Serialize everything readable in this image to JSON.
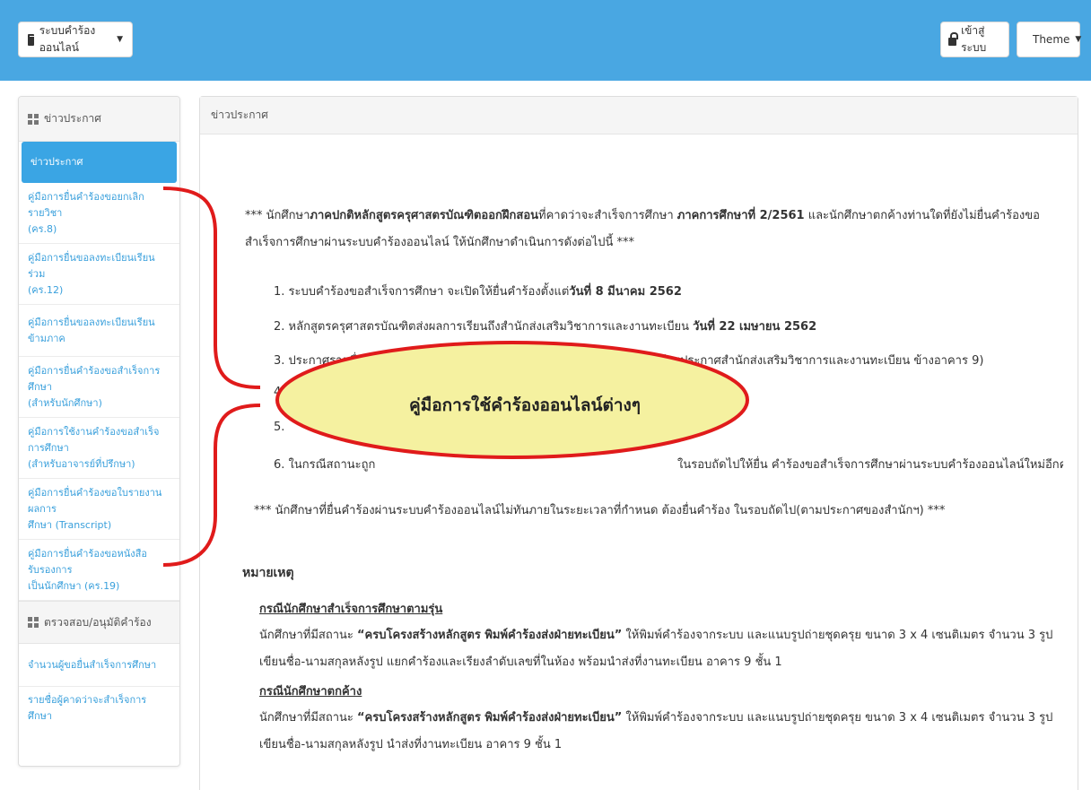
{
  "navbar": {
    "brand_label": "ระบบคำร้องออนไลน์",
    "login_label": "เข้าสู่ระบบ",
    "theme_label": "Theme",
    "background": "#49a7e2"
  },
  "sidebar": {
    "section1_title": "ข่าวประกาศ",
    "items": [
      {
        "label": "ข่าวประกาศ",
        "active": true
      },
      {
        "line1": "คู่มือการยื่นคำร้องขอยกเลิกรายวิชา",
        "line2": "(คร.8)"
      },
      {
        "line1": "คู่มือการยื่นขอลงทะเบียนเรียนร่วม",
        "line2": "(คร.12)"
      },
      {
        "label": "คู่มือการยื่นขอลงทะเบียนเรียนข้ามภาค"
      },
      {
        "line1": "คู่มือการยื่นคำร้องขอสำเร็จการศึกษา",
        "line2": "(สำหรับนักศึกษา)"
      },
      {
        "line1": "คู่มือการใช้งานคำร้องขอสำเร็จการศึกษา",
        "line2": "(สำหรับอาจารย์ที่ปรึกษา)"
      },
      {
        "line1": "คู่มือการยื่นคำร้องขอใบรายงานผลการ",
        "line2": "ศึกษา (Transcript)"
      },
      {
        "line1": "คู่มือการยื่นคำร้องขอหนังสือรับรองการ",
        "line2": "เป็นนักศึกษา (คร.19)"
      }
    ],
    "section2_title": "ตรวจสอบ/อนุมัติคำร้อง",
    "items2": [
      {
        "label": "จำนวนผู้ขอยื่นสำเร็จการศึกษา"
      },
      {
        "label": "รายชื่อผู้คาดว่าจะสำเร็จการศึกษา"
      }
    ]
  },
  "main": {
    "header_title": "ข่าวประกาศ",
    "intro_pre": "*** นักศึกษา",
    "intro_b1": "ภาคปกติหลักสูตรครุศาสตรบัณฑิตออกฝึกสอน",
    "intro_mid": "ที่คาดว่าจะสำเร็จการศึกษา ",
    "intro_b2": "ภาคการศึกษาที่ 2/2561",
    "intro_post": " และนักศึกษาตกค้างท่านใดที่ยังไม่ยื่นคำร้องขอสำเร็จการศึกษาผ่านระบบคำร้องออนไลน์ ให้นักศึกษาดำเนินการดังต่อไปนี้ ***",
    "step1_pre": "1. ระบบคำร้องขอสำเร็จการศึกษา จะเปิดให้ยื่นคำร้องตั้งแต่",
    "step1_b": "วันที่ 8 มีนาคม 2562",
    "step2_pre": "2. หลักสูตรครุศาสตรบัณฑิตส่งผลการเรียนถึงสำนักส่งเสริมวิชาการและงานทะเบียน ",
    "step2_b": "วันที่ 22 เมษายน 2562",
    "step3_a": "3. ประกาศรายชื่อผู้",
    "step3_b": "ป้ายประกาศสำนักส่งเสริมวิชาการและงานทะเบียน ข้างอาคาร 9)",
    "step4": "4.",
    "step5": "5.",
    "step6_a": "6. ในกรณีสถานะถูก",
    "step6_b": "ในรอบถัดไปให้ยื่น คำร้องขอสำเร็จการศึกษาผ่านระบบคำร้องออนไลน์ใหม่อีกครั้ง",
    "note_all": "*** นักศึกษาที่ยื่นคำร้องผ่านระบบคำร้องออนไลน์ไม่ทันภายในระยะเวลาที่กำหนด ต้องยื่นคำร้อง ในรอบถัดไป(ตามประกาศของสำนักฯ) ***",
    "remark_title": "หมายเหตุ",
    "case1_title": "กรณีนักศึกษาสำเร็จการศึกษาตามรุ่น",
    "case1_pre": "นักศึกษาที่มีสถานะ ",
    "case1_b": "“ครบโครงสร้างหลักสูตร พิมพ์คำร้องส่งฝ่ายทะเบียน”",
    "case1_post": " ให้พิมพ์คำร้องจากระบบ และแนบรูปถ่ายชุดครุย ขนาด 3 x 4 เซนติเมตร จำนวน 3 รูป เขียนชื่อ-นามสกุลหลังรูป แยกคำร้องและเรียงลำดับเลขที่ในห้อง พร้อมนำส่งที่งานทะเบียน อาคาร 9 ชั้น 1",
    "case2_title": "กรณีนักศึกษาตกค้าง",
    "case2_pre": "นักศึกษาที่มีสถานะ ",
    "case2_b": "“ครบโครงสร้างหลักสูตร พิมพ์คำร้องส่งฝ่ายทะเบียน”",
    "case2_post": " ให้พิมพ์คำร้องจากระบบ และแนบรูปถ่ายชุดครุย ขนาด 3 x 4 เซนติเมตร จำนวน 3 รูป เขียนชื่อ-นามสกุลหลังรูป นำส่งที่งานทะเบียน อาคาร 9 ชั้น 1"
  },
  "callout": {
    "text": "คู่มือการใช้คำร้องออนไลน์ต่างๆ",
    "fill": "#f5f1a0",
    "stroke": "#e01b1b"
  }
}
